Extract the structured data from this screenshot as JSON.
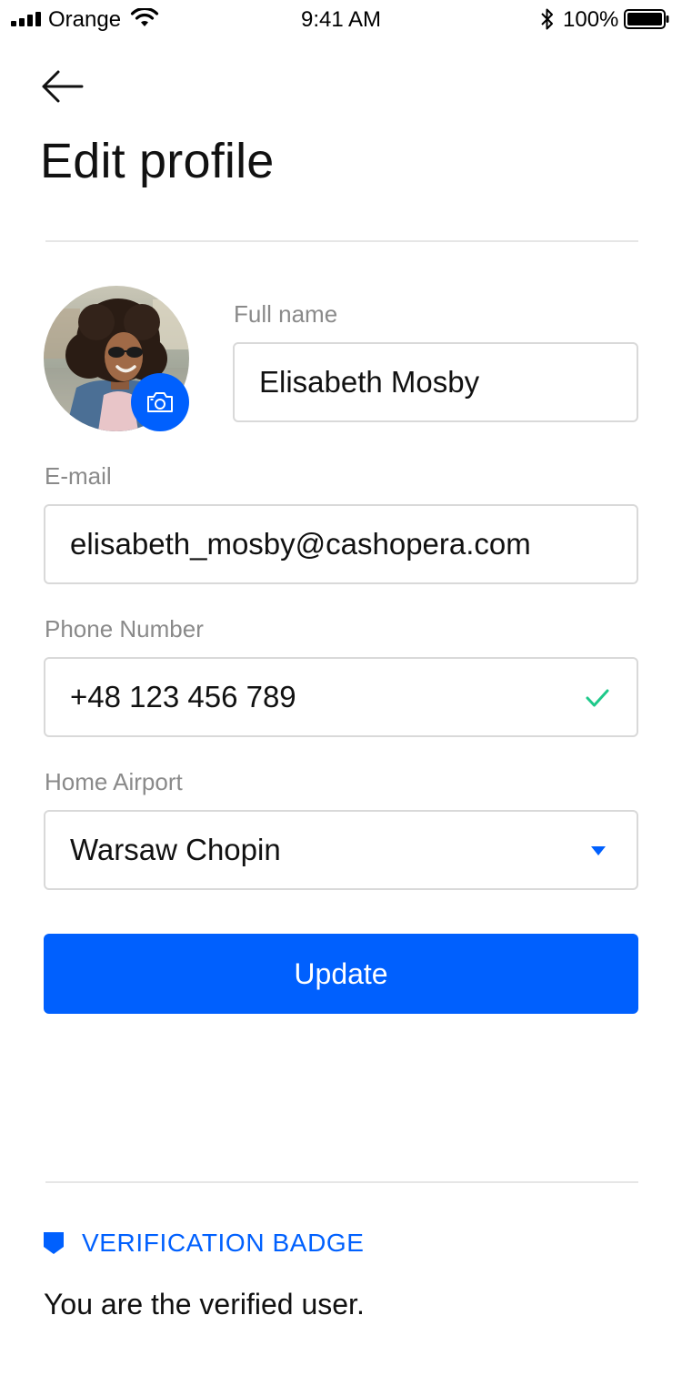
{
  "status_bar": {
    "carrier": "Orange",
    "time": "9:41 AM",
    "battery": "100%"
  },
  "icons": {
    "back": "arrow-left-icon",
    "camera": "camera-icon",
    "check": "check-icon",
    "dropdown": "caret-down-icon",
    "badge": "shield-badge-icon"
  },
  "page": {
    "title": "Edit profile"
  },
  "profile": {
    "full_name_label": "Full name",
    "full_name": "Elisabeth Mosby",
    "email_label": "E-mail",
    "email": "elisabeth_mosby@cashopera.com",
    "phone_label": "Phone Number",
    "phone": "+48 123 456 789",
    "airport_label": "Home Airport",
    "airport": "Warsaw Chopin"
  },
  "actions": {
    "update_label": "Update"
  },
  "verification": {
    "title": "VERIFICATION BADGE",
    "text": "You are the verified user."
  },
  "colors": {
    "accent": "#0060fe",
    "success": "#1ec98a",
    "border": "#d9d9d9",
    "label": "#8a8a8a"
  }
}
